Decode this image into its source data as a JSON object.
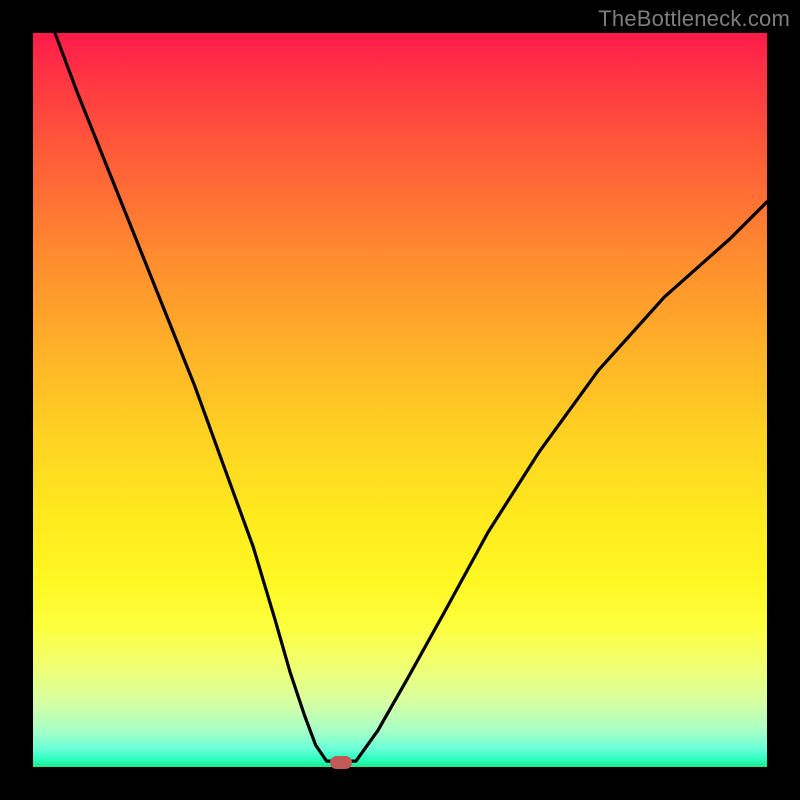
{
  "watermark": "TheBottleneck.com",
  "chart_data": {
    "type": "line",
    "title": "",
    "xlabel": "",
    "ylabel": "",
    "xlim": [
      0,
      100
    ],
    "ylim": [
      0,
      100
    ],
    "grid": false,
    "series": [
      {
        "name": "left-branch",
        "x": [
          3,
          6,
          10,
          14,
          18,
          22,
          26,
          30,
          33,
          35,
          37,
          38.5,
          40
        ],
        "y": [
          100,
          92,
          82,
          72,
          62,
          52,
          41,
          30,
          20,
          13,
          7,
          3,
          0.8
        ]
      },
      {
        "name": "flat-bottom",
        "x": [
          40,
          44
        ],
        "y": [
          0.8,
          0.8
        ]
      },
      {
        "name": "right-branch",
        "x": [
          44,
          47,
          51,
          56,
          62,
          69,
          77,
          86,
          95,
          100
        ],
        "y": [
          0.8,
          5,
          12,
          21,
          32,
          43,
          54,
          64,
          72,
          77
        ]
      }
    ],
    "marker": {
      "x": 42,
      "y": 0.5,
      "color": "#c05a56"
    },
    "gradient_stops": [
      {
        "pos": 0,
        "color": "#ff1a49"
      },
      {
        "pos": 30,
        "color": "#ff8a2f"
      },
      {
        "pos": 66,
        "color": "#ffea1e"
      },
      {
        "pos": 86,
        "color": "#f1ff6f"
      },
      {
        "pos": 100,
        "color": "#1de98b"
      }
    ]
  }
}
